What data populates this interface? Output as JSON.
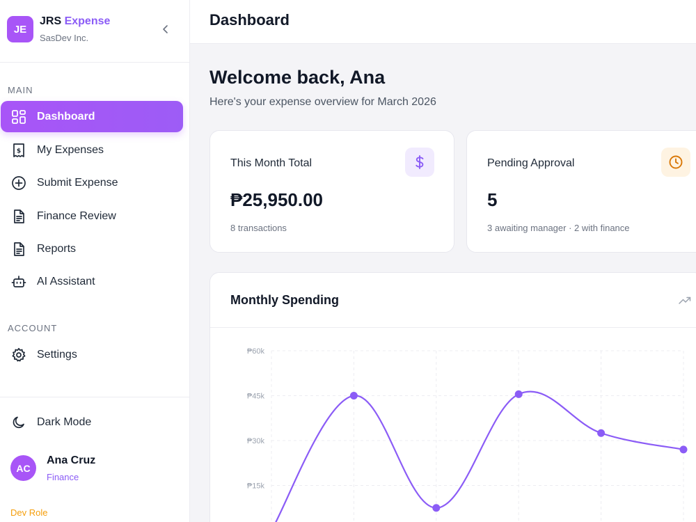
{
  "brand": {
    "logo_text": "JE",
    "name_prefix": "JRS",
    "name_accent": "Expense",
    "subtitle": "SasDev Inc.",
    "accent_color": "#a855f7"
  },
  "sidebar": {
    "main_label": "MAIN",
    "account_label": "ACCOUNT",
    "items": [
      {
        "label": "Dashboard",
        "icon": "dashboard-grid-icon",
        "active": true
      },
      {
        "label": "My Expenses",
        "icon": "receipt-icon",
        "active": false
      },
      {
        "label": "Submit Expense",
        "icon": "plus-circle-icon",
        "active": false
      },
      {
        "label": "Finance Review",
        "icon": "document-icon",
        "active": false
      },
      {
        "label": "Reports",
        "icon": "report-icon",
        "active": false
      },
      {
        "label": "AI Assistant",
        "icon": "robot-icon",
        "active": false
      }
    ],
    "account_items": [
      {
        "label": "Settings",
        "icon": "gear-icon"
      }
    ],
    "dark_mode_label": "Dark Mode"
  },
  "user": {
    "initials": "AC",
    "name": "Ana Cruz",
    "role": "Finance",
    "dev_role": "Dev Role"
  },
  "header": {
    "title": "Dashboard"
  },
  "main": {
    "welcome": "Welcome back, Ana",
    "subtitle": "Here's your expense overview for March 2026",
    "stats": [
      {
        "title": "This Month Total",
        "value": "₱25,950.00",
        "sub": "8 transactions",
        "icon": "dollar-icon",
        "icon_color": "#8b5cf6",
        "icon_bg": "#f1ebfe"
      },
      {
        "title": "Pending Approval",
        "value": "5",
        "sub": "3 awaiting manager · 2 with finance",
        "icon": "clock-icon",
        "icon_color": "#d97706",
        "icon_bg": "#fef3e2"
      }
    ]
  },
  "chart_data": {
    "type": "line",
    "title": "Monthly Spending",
    "y_tick_labels": [
      "₱60k",
      "₱45k",
      "₱30k",
      "₱15k"
    ],
    "ylim": [
      0,
      60000
    ],
    "y_ticks": [
      60000,
      45000,
      30000,
      15000
    ],
    "values": [
      0,
      45000,
      7500,
      45500,
      32500,
      27000
    ],
    "grid": true,
    "line_color": "#8b5cf6"
  }
}
